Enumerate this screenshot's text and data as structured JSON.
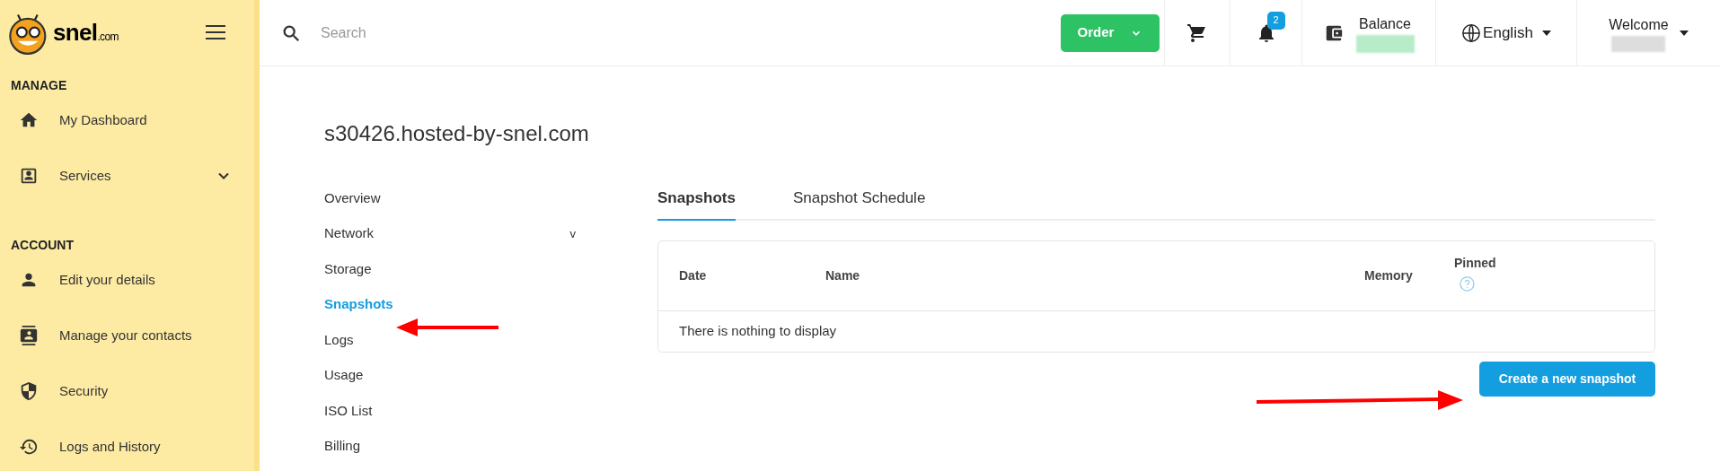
{
  "logo": {
    "name": "snel",
    "suffix": ".com"
  },
  "sidebar": {
    "sections": [
      {
        "title": "MANAGE",
        "items": [
          {
            "label": "My Dashboard",
            "kind": "home",
            "expandable": false
          },
          {
            "label": "Services",
            "kind": "contact",
            "expandable": true
          }
        ]
      },
      {
        "title": "ACCOUNT",
        "items": [
          {
            "label": "Edit your details",
            "kind": "person",
            "expandable": false
          },
          {
            "label": "Manage your contacts",
            "kind": "contacts",
            "expandable": false
          },
          {
            "label": "Security",
            "kind": "shield",
            "expandable": false
          },
          {
            "label": "Logs and History",
            "kind": "history",
            "expandable": false
          }
        ]
      }
    ]
  },
  "topbar": {
    "search": {
      "placeholder": "Search"
    },
    "order_button": "Order",
    "notifications": {
      "count": "2"
    },
    "balance": {
      "label": "Balance"
    },
    "language": "English",
    "welcome": "Welcome"
  },
  "page": {
    "title": "s30426.hosted-by-snel.com",
    "subnav": [
      {
        "label": "Overview",
        "selected": false
      },
      {
        "label": "Network",
        "selected": false,
        "toggle": "v"
      },
      {
        "label": "Storage",
        "selected": false
      },
      {
        "label": "Snapshots",
        "selected": true
      },
      {
        "label": "Logs",
        "selected": false
      },
      {
        "label": "Usage",
        "selected": false
      },
      {
        "label": "ISO List",
        "selected": false
      },
      {
        "label": "Billing",
        "selected": false
      }
    ],
    "tabs": [
      {
        "label": "Snapshots",
        "selected": true
      },
      {
        "label": "Snapshot Schedule",
        "selected": false
      }
    ],
    "table": {
      "columns": [
        "Date",
        "Name",
        "Memory",
        "Pinned"
      ],
      "empty_message": "There is nothing to display"
    },
    "create_button": "Create a new snapshot"
  }
}
